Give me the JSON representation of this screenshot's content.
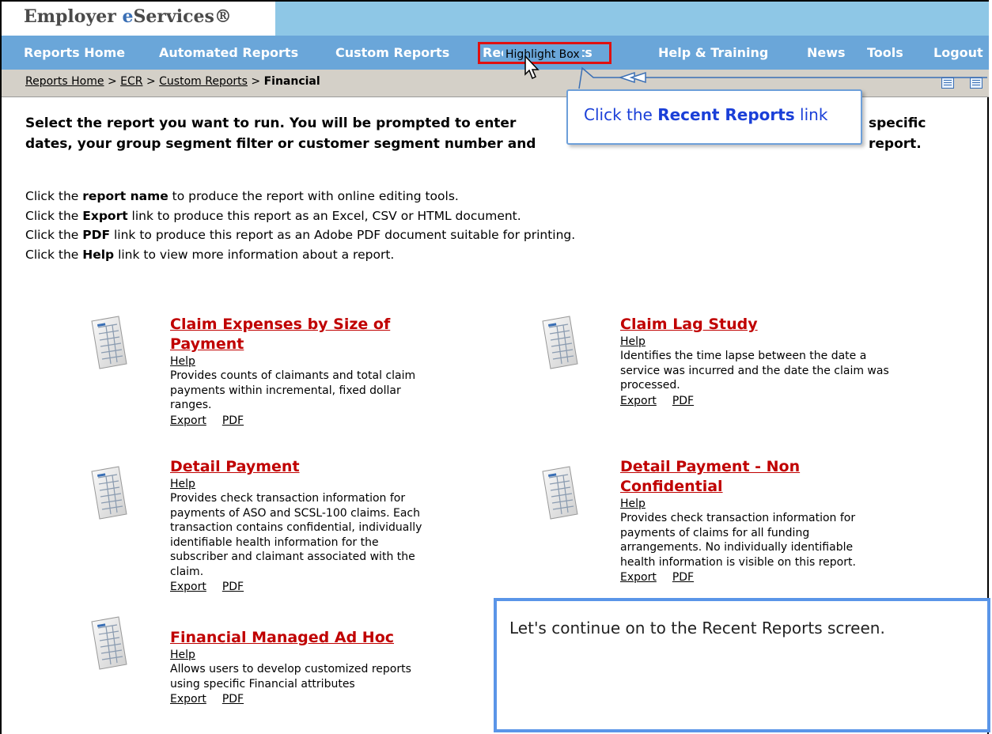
{
  "header": {
    "brand": "Employer eServices®",
    "brand_parts": [
      "Employer ",
      "e",
      "Services®"
    ]
  },
  "nav": {
    "items": [
      "Reports Home",
      "Automated Reports",
      "Custom Reports",
      "Recent Reports",
      "Help & Training",
      "News",
      "Tools",
      "Logout"
    ]
  },
  "breadcrumb": {
    "items": [
      "Reports Home",
      "ECR",
      "Custom Reports",
      "Financial"
    ],
    "separator": ">"
  },
  "intro": {
    "line1": "Select the report you want to run.  You will be prompted to enter",
    "line1_end": "specific",
    "line2": "dates, your group segment filter or customer segment number and",
    "line2_end": "report."
  },
  "instructions": [
    {
      "pre": "Click the ",
      "bold": "report name",
      "post": " to produce the report with online editing tools."
    },
    {
      "pre": "Click the ",
      "bold": "Export",
      "post": " link to produce this report as an Excel, CSV or HTML document."
    },
    {
      "pre": "Click the ",
      "bold": "PDF",
      "post": " link to produce this report as an Adobe PDF document suitable for printing."
    },
    {
      "pre": "Click the ",
      "bold": "Help",
      "post": " link to view more information about a report."
    }
  ],
  "reports": [
    {
      "title": "Claim Expenses by Size of Payment",
      "help": "Help",
      "description": "Provides counts of claimants and total claim payments within incremental, fixed dollar ranges.",
      "export": "Export",
      "pdf": "PDF"
    },
    {
      "title": "Claim Lag Study",
      "help": "Help",
      "description": "Identifies the time lapse between the date a service was incurred and the date the claim was processed.",
      "export": "Export",
      "pdf": "PDF"
    },
    {
      "title": "Detail Payment",
      "help": "Help",
      "description": "Provides check transaction information for payments of ASO and SCSL-100 claims.  Each transaction contains confidential, individually identifiable health information for the subscriber and claimant associated with the claim.",
      "export": "Export",
      "pdf": "PDF"
    },
    {
      "title": "Detail Payment - Non Confidential",
      "help": "Help",
      "description": "Provides check transaction information for payments of claims for all funding arrangements.  No individually identifiable health information is visible on this report.",
      "export": "Export",
      "pdf": "PDF"
    },
    {
      "title": "Financial Managed Ad Hoc",
      "help": "Help",
      "description": "Allows users to develop customized reports using specific Financial attributes",
      "export": "Export",
      "pdf": "PDF"
    }
  ],
  "overlay": {
    "highlight_label": "Highlight Box",
    "callout_pre": "Click the ",
    "callout_bold": "Recent Reports",
    "callout_post": " link",
    "caption": "Let's continue on to the Recent Reports screen."
  },
  "colors": {
    "topbar": "#8ec7e6",
    "navbar": "#6aa6d9",
    "report_title": "#c00000",
    "highlight": "#e01010",
    "callout_text": "#1a3fd8"
  }
}
